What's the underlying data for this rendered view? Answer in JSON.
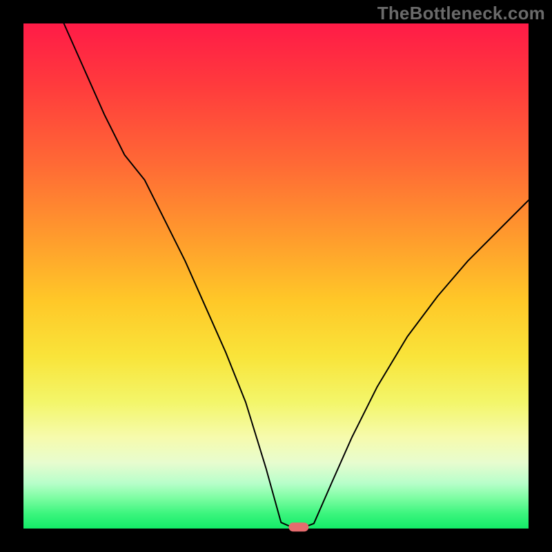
{
  "watermark": "TheBottleneck.com",
  "chart_data": {
    "type": "line",
    "title": "",
    "xlabel": "",
    "ylabel": "",
    "xlim": [
      0,
      1
    ],
    "ylim": [
      0,
      1
    ],
    "grid": false,
    "legend": false,
    "background_gradient": {
      "direction": "vertical",
      "stops": [
        {
          "pos": 0.0,
          "color": "#ff1b47"
        },
        {
          "pos": 0.12,
          "color": "#ff3a3d"
        },
        {
          "pos": 0.28,
          "color": "#ff6a35"
        },
        {
          "pos": 0.42,
          "color": "#ff9a2d"
        },
        {
          "pos": 0.55,
          "color": "#ffc828"
        },
        {
          "pos": 0.66,
          "color": "#f9e43a"
        },
        {
          "pos": 0.75,
          "color": "#f3f66a"
        },
        {
          "pos": 0.82,
          "color": "#f6fbad"
        },
        {
          "pos": 0.87,
          "color": "#e7fccf"
        },
        {
          "pos": 0.91,
          "color": "#b8feca"
        },
        {
          "pos": 0.94,
          "color": "#7cfda2"
        },
        {
          "pos": 0.97,
          "color": "#3cf57e"
        },
        {
          "pos": 1.0,
          "color": "#13eb67"
        }
      ]
    },
    "series": [
      {
        "name": "bottleneck-curve",
        "stroke": "#000000",
        "stroke_width": 2,
        "x": [
          0.08,
          0.12,
          0.16,
          0.2,
          0.24,
          0.28,
          0.32,
          0.36,
          0.4,
          0.44,
          0.48,
          0.51,
          0.533,
          0.554,
          0.575,
          0.61,
          0.65,
          0.7,
          0.76,
          0.82,
          0.88,
          0.94,
          1.0
        ],
        "y": [
          1.0,
          0.91,
          0.82,
          0.74,
          0.69,
          0.61,
          0.53,
          0.44,
          0.35,
          0.25,
          0.12,
          0.012,
          0.002,
          0.002,
          0.01,
          0.09,
          0.18,
          0.28,
          0.38,
          0.46,
          0.53,
          0.59,
          0.65
        ]
      }
    ],
    "marker": {
      "shape": "rounded-rect",
      "color": "#e56b6e",
      "x": 0.545,
      "y": 0.003,
      "width_frac": 0.04,
      "height_frac": 0.018
    }
  }
}
